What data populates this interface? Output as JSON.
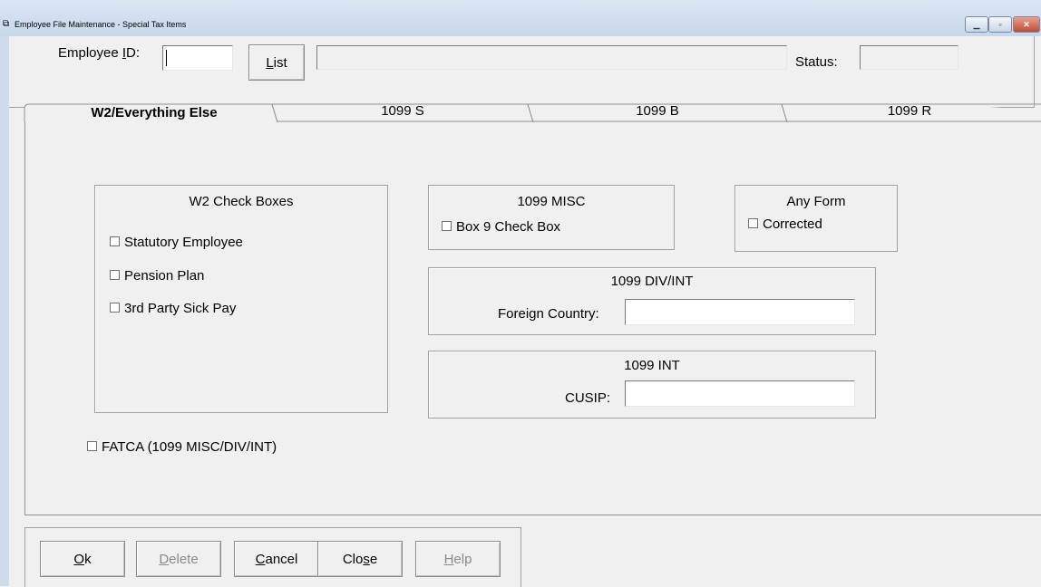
{
  "window": {
    "title": "Employee File Maintenance - Special Tax Items",
    "minimize_glyph": "▁",
    "maximize_glyph": "▫",
    "close_glyph": "✕"
  },
  "header": {
    "employee_id_label": "Employee ID:",
    "employee_id_value": "",
    "list_button": "List",
    "employee_name_value": "",
    "status_label": "Status:",
    "status_value": ""
  },
  "tabs": [
    {
      "label": "W2/Everything Else",
      "active": true
    },
    {
      "label": "1099 S",
      "active": false
    },
    {
      "label": "1099 B",
      "active": false
    },
    {
      "label": "1099 R",
      "active": false
    }
  ],
  "w2_group": {
    "title": "W2 Check Boxes",
    "items": [
      {
        "label": "Statutory Employee",
        "checked": false
      },
      {
        "label": "Pension Plan",
        "checked": false
      },
      {
        "label": "3rd Party Sick Pay",
        "checked": false
      }
    ]
  },
  "misc_group": {
    "title": "1099 MISC",
    "item": {
      "label": "Box 9 Check Box",
      "checked": false
    }
  },
  "any_form_group": {
    "title": "Any Form",
    "item": {
      "label": "Corrected",
      "checked": false
    }
  },
  "div_int_group": {
    "title": "1099 DIV/INT",
    "field_label": "Foreign Country:",
    "field_value": ""
  },
  "int_group": {
    "title": "1099 INT",
    "field_label": "CUSIP:",
    "field_value": ""
  },
  "fatca": {
    "label": "FATCA (1099 MISC/DIV/INT)",
    "checked": false
  },
  "buttons": {
    "ok": "Ok",
    "delete": "Delete",
    "cancel": "Cancel",
    "close": "Close",
    "help": "Help"
  }
}
